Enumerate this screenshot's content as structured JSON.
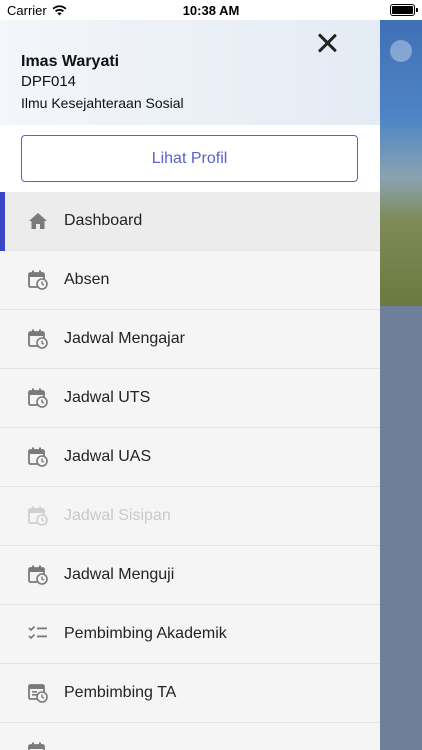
{
  "status_bar": {
    "carrier": "Carrier",
    "time": "10:38 AM"
  },
  "drawer": {
    "user": {
      "name": "Imas Waryati",
      "id": "DPF014",
      "department": "Ilmu Kesejahteraan Sosial"
    },
    "profile_button_label": "Lihat Profil",
    "accent_color": "#3b46c4",
    "menu": [
      {
        "label": "Dashboard",
        "icon": "home-icon",
        "active": true
      },
      {
        "label": "Absen",
        "icon": "calendar-clock-icon"
      },
      {
        "label": "Jadwal Mengajar",
        "icon": "calendar-clock-icon"
      },
      {
        "label": "Jadwal UTS",
        "icon": "calendar-clock-icon"
      },
      {
        "label": "Jadwal UAS",
        "icon": "calendar-clock-icon"
      },
      {
        "label": "Jadwal Sisipan",
        "icon": "calendar-clock-icon",
        "disabled": true
      },
      {
        "label": "Jadwal Menguji",
        "icon": "calendar-clock-icon"
      },
      {
        "label": "Pembimbing Akademik",
        "icon": "checklist-icon"
      },
      {
        "label": "Pembimbing TA",
        "icon": "table-clock-icon"
      },
      {
        "label": "",
        "icon": "calendar-clock-icon"
      }
    ]
  }
}
